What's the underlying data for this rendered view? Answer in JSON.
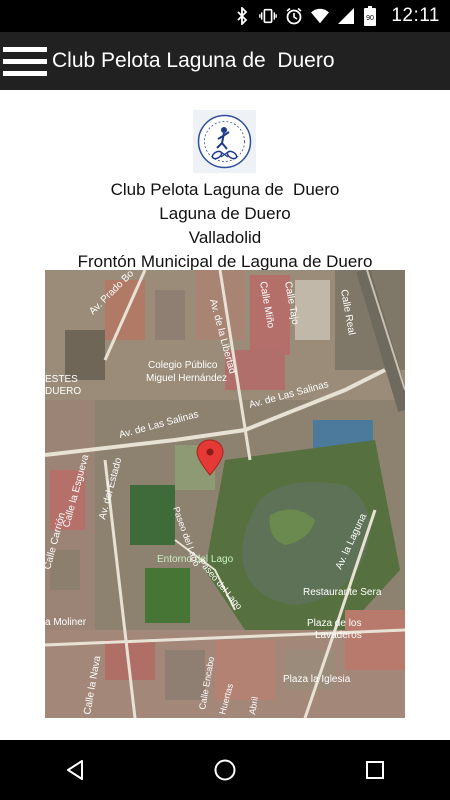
{
  "status_bar": {
    "time": "12:11",
    "battery_level": "90",
    "icons": [
      "bluetooth-icon",
      "vibrate-icon",
      "alarm-icon",
      "wifi-icon",
      "signal-icon",
      "battery-icon"
    ]
  },
  "app_bar": {
    "title": "Club Pelota Laguna de  Duero",
    "menu_icon": "hamburger-menu-icon"
  },
  "club": {
    "name": "Club Pelota Laguna de  Duero",
    "town": "Laguna de Duero",
    "province": "Valladolid",
    "venue": "Frontón Municipal de Laguna de Duero"
  },
  "map": {
    "labels": {
      "prado_bo": "Av. Prado Bo",
      "colegio_1": "Colegio Público",
      "colegio_2": "Miguel Hernández",
      "libertad": "Av. de la Libertad",
      "mino": "Calle Miño",
      "tajo": "Calle Tajo",
      "royal": "Calle Real",
      "salinas_1": "Av. de Las Salinas",
      "salinas_2": "Av. de Las Salinas",
      "estes": "ESTES",
      "duero": "DUERO",
      "entorno": "Entorno del Lago",
      "paseo_lago_1": "Paseo del Lago",
      "paseo_lago_2": "Paseo del Lago",
      "estado": "Av. del Estado",
      "esgueva": "Calle la Esgueva",
      "carrion": "Calle Carrión",
      "laguna": "Av. la Laguna",
      "restaurante": "Restaurante Sera",
      "plaza_lavaderos_1": "Plaza de los",
      "plaza_lavaderos_2": "Lavaderos",
      "plaza_iglesia": "Plaza la Iglesia",
      "moliner": "a Moliner",
      "nava": "Calle la Nava",
      "huertas": "Huertas",
      "encabo": "Calle Encabo",
      "abril": "Abril"
    },
    "marker_icon": "map-pin-icon",
    "marker_color": "#e53935"
  },
  "nav_bar": {
    "back_icon": "back-icon",
    "home_icon": "home-icon",
    "recents_icon": "recents-icon"
  }
}
